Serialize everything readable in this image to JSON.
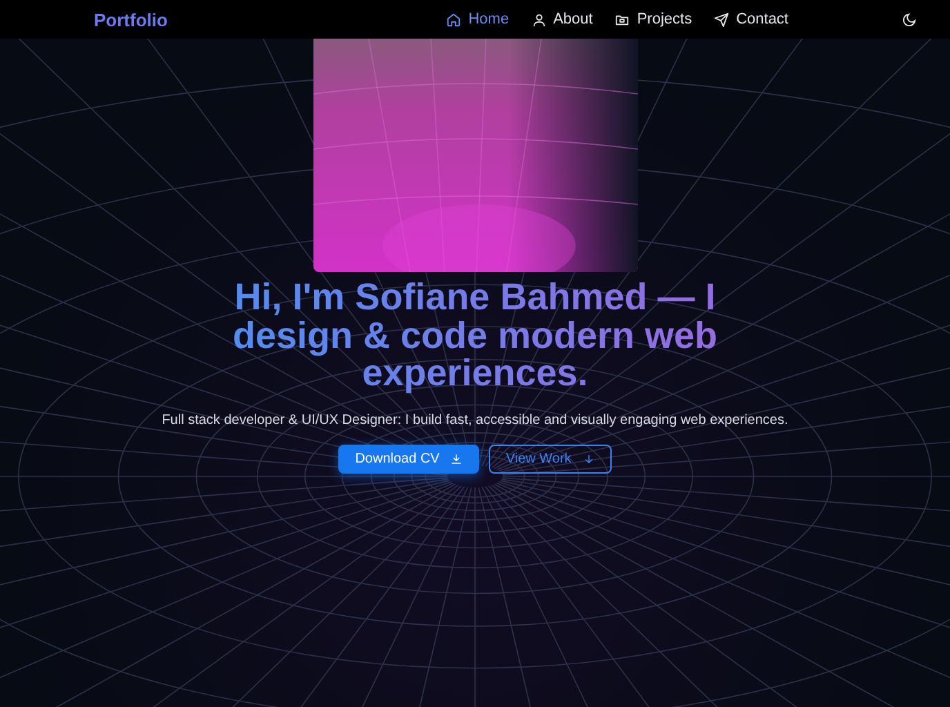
{
  "nav": {
    "logo": "Portfolio",
    "links": [
      {
        "label": "Home",
        "kind": "home",
        "selected": true
      },
      {
        "label": "About",
        "kind": "user",
        "selected": false
      },
      {
        "label": "Projects",
        "kind": "folder",
        "selected": false
      },
      {
        "label": "Contact",
        "kind": "send",
        "selected": false
      }
    ]
  },
  "hero": {
    "title": "Hi, I'm Sofiane Bahmed — I design & code modern web experiences.",
    "subtitle": "Full stack developer & UI/UX Designer: I build fast, accessible and visually engaging web experiences.",
    "buttons": [
      {
        "label": "Download CV",
        "kind": "primary"
      },
      {
        "label": "View Work",
        "kind": "outline"
      }
    ]
  }
}
